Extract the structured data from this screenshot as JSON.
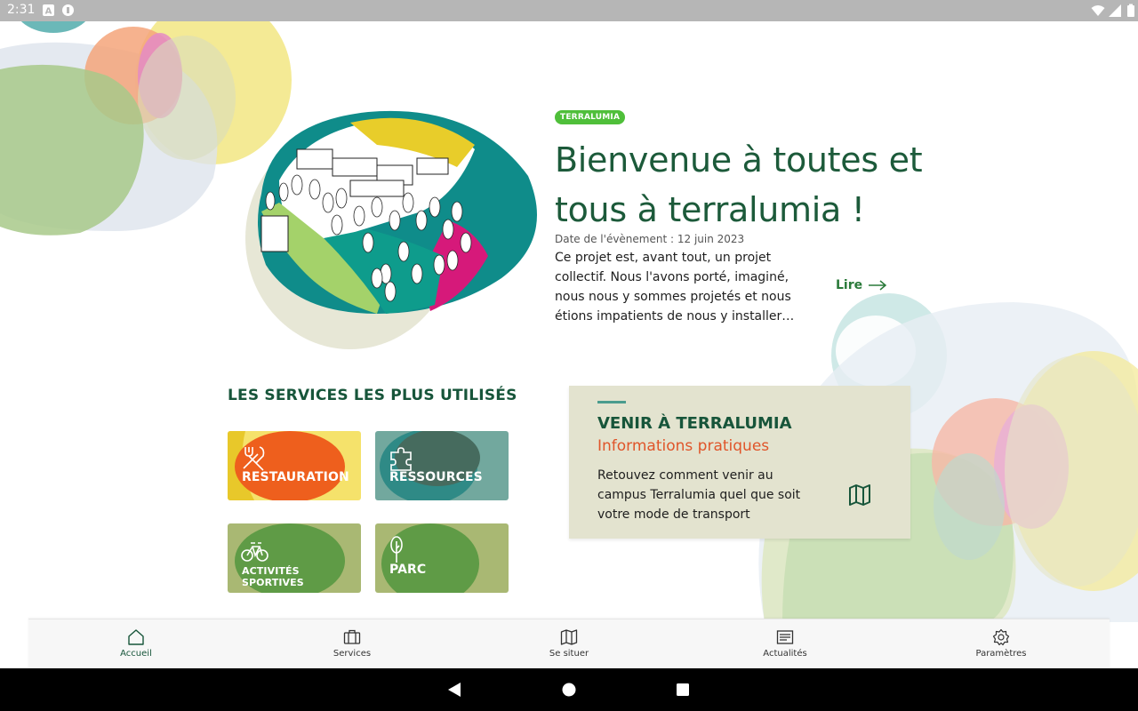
{
  "status_bar": {
    "time": "2:31"
  },
  "hero": {
    "badge": "TERRALUMIA",
    "title": "Bienvenue à toutes et tous à terralumia !",
    "date": "Date de l'évènement : 12 juin 2023",
    "description": "Ce projet est, avant tout, un projet collectif. Nous l'avons porté, imaginé, nous nous y sommes projetés et nous étions impatients de nous y installer…",
    "read_label": "Lire"
  },
  "services": {
    "title": "LES SERVICES LES PLUS UTILISÉS",
    "items": [
      {
        "label": "RESTAURATION",
        "icon": "fork-knife-icon"
      },
      {
        "label": "RESSOURCES",
        "icon": "puzzle-icon"
      },
      {
        "label": "ACTIVITÉS SPORTIVES",
        "icon": "bicycle-icon"
      },
      {
        "label": "PARC",
        "icon": "tree-icon"
      }
    ]
  },
  "info_card": {
    "title": "VENIR À TERRALUMIA",
    "subtitle": "Informations pratiques",
    "description": "Retouvez comment venir au campus Terralumia quel que soit votre mode de transport"
  },
  "bottom_nav": {
    "items": [
      {
        "label": "Accueil",
        "icon": "home-icon",
        "active": true
      },
      {
        "label": "Services",
        "icon": "briefcase-icon",
        "active": false
      },
      {
        "label": "Se situer",
        "icon": "map-icon",
        "active": false
      },
      {
        "label": "Actualités",
        "icon": "news-icon",
        "active": false
      },
      {
        "label": "Paramètres",
        "icon": "gear-icon",
        "active": false
      }
    ]
  },
  "colors": {
    "brand_green": "#17553a",
    "accent_orange": "#e0552a",
    "badge_green": "#4fbf3a",
    "card_bg": "#e3e3cf"
  }
}
